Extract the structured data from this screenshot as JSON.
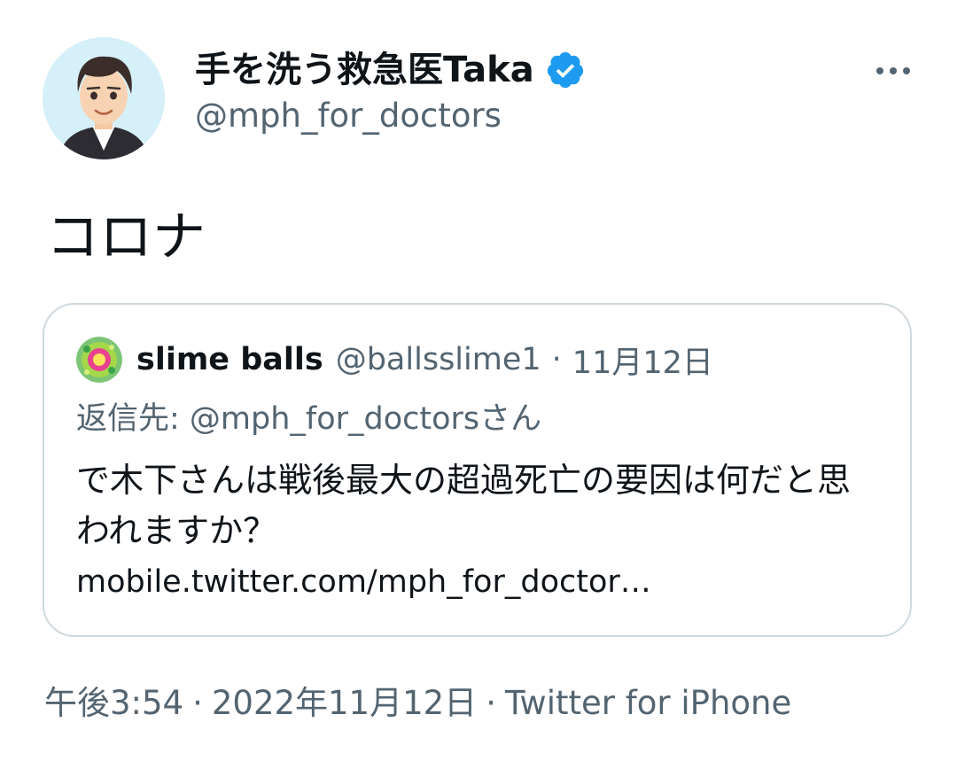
{
  "author": {
    "display_name": "手を洗う救急医Taka",
    "handle": "@mph_for_doctors",
    "avatar": "avatar-cartoon-man",
    "verified_icon": "verified-badge-icon"
  },
  "tweet": {
    "text": "コロナ"
  },
  "quoted_tweet": {
    "name": "slime balls",
    "handle": "@ballsslime1",
    "separator": "·",
    "date": "11月12日",
    "reply_to": "返信先: @mph_for_doctorsさん",
    "body": "で木下さんは戦後最大の超過死亡の要因は何だと思われますか？",
    "link": "mobile.twitter.com/mph_for_doctor…"
  },
  "meta": {
    "time": "午後3:54",
    "separator1": "·",
    "date": "2022年11月12日",
    "separator2": "·",
    "source": "Twitter for iPhone"
  },
  "colors": {
    "text_primary": "#0f1419",
    "text_secondary": "#536471",
    "verified_blue": "#1d9bf0",
    "border": "#cfd9de"
  },
  "icons": {
    "more": "more-options-icon"
  }
}
